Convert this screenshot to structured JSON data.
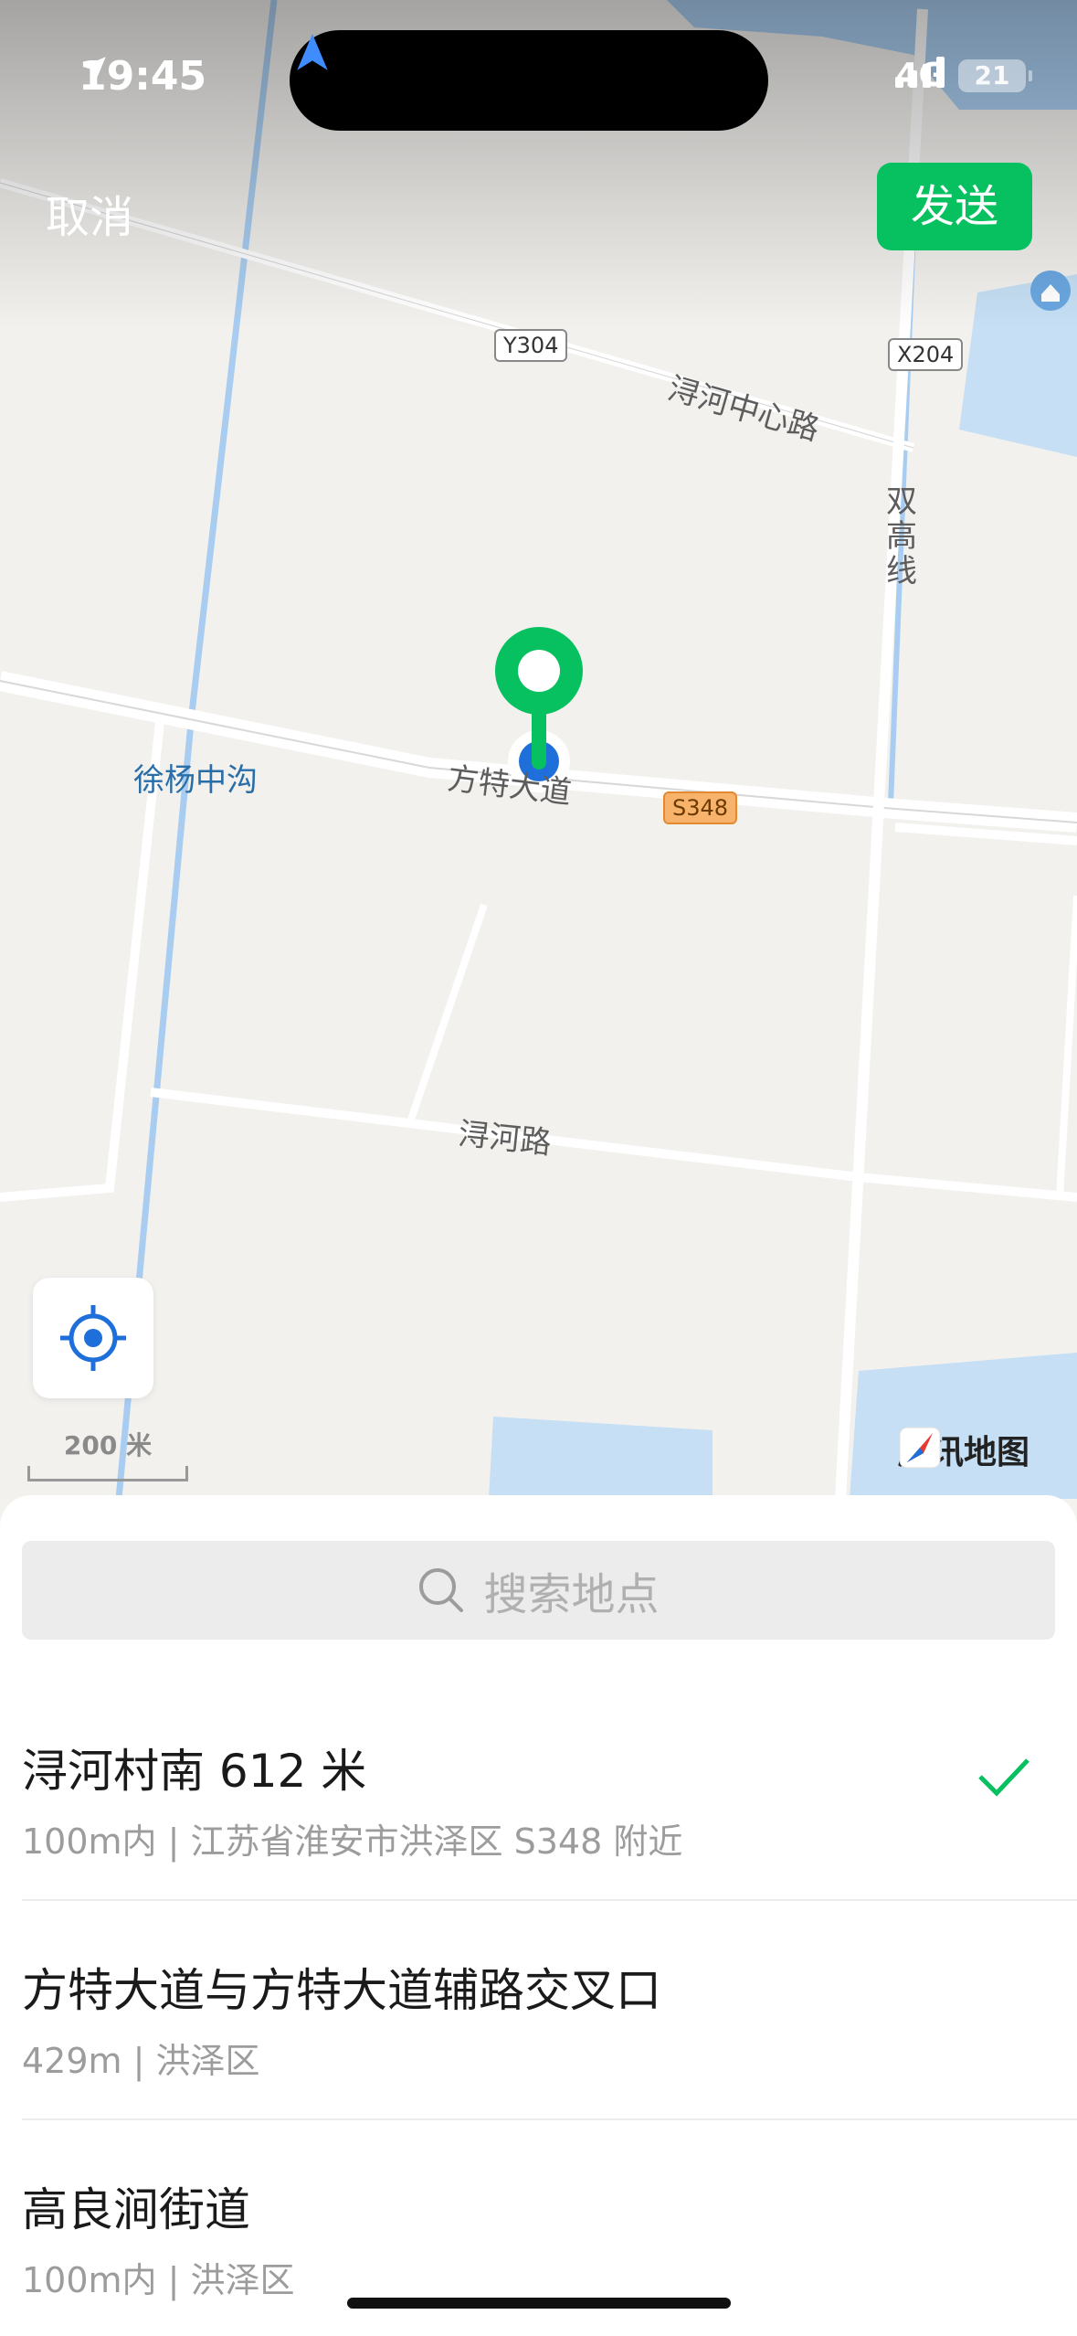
{
  "status_bar": {
    "time": "19:45",
    "network": "4G",
    "battery": "21"
  },
  "header": {
    "cancel_label": "取消",
    "send_label": "发送"
  },
  "map": {
    "road_labels": {
      "xunhe_center": "浔河中心路",
      "shuanggao": "双高线",
      "fangte": "方特大道",
      "xunhe": "浔河路",
      "xuyang": "徐杨中沟"
    },
    "badges": {
      "y304": "Y304",
      "x204": "X204",
      "s348": "S348"
    },
    "scale_label": "200 米",
    "brand_label": "腾讯地图",
    "colors": {
      "water": "#a9cdf0",
      "pin": "#07c160",
      "location": "#1e6fd9"
    }
  },
  "search": {
    "placeholder": "搜索地点"
  },
  "results": [
    {
      "title": "浔河村南 612 米",
      "subtitle": "100m内 | 江苏省淮安市洪泽区 S348 附近",
      "selected": true
    },
    {
      "title": "方特大道与方特大道辅路交叉口",
      "subtitle": "429m | 洪泽区",
      "selected": false
    },
    {
      "title": "高良涧街道",
      "subtitle": "100m内 | 洪泽区",
      "selected": false
    }
  ]
}
